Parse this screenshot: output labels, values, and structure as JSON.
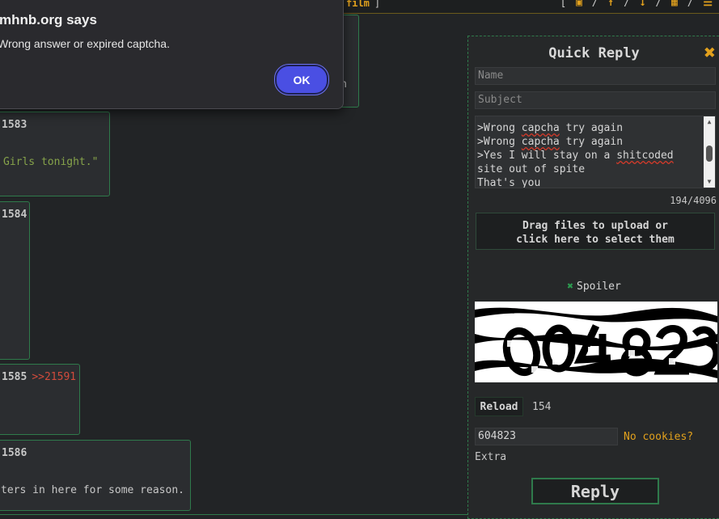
{
  "topbar": {
    "film_label": "film",
    "close_bracket": "]",
    "nav": [
      "[",
      "/",
      "/",
      "/",
      "/",
      "/"
    ]
  },
  "dialog": {
    "title": "mhnb.org says",
    "message": "Wrong answer or expired captcha.",
    "ok_label": "OK",
    "accent": "#4a4fe3"
  },
  "posts": [
    {
      "num": "1583",
      "ref": "",
      "text": "Girls tonight.\""
    },
    {
      "num": "1584",
      "ref": "",
      "text": ""
    },
    {
      "num": "1585",
      "ref": ">>21591",
      "text": ""
    },
    {
      "num": "1586",
      "ref": "",
      "text": "ters in here for some reason."
    }
  ],
  "quick_reply": {
    "title": "Quick Reply",
    "close_icon": "close-icon",
    "name_placeholder": "Name",
    "subject_placeholder": "Subject",
    "message_lines": [
      ">            ",
      ">Wrong capcha try again",
      ">Wrong capcha try again",
      ">Yes I will stay on a shitcoded",
      "site out of spite",
      "That's you"
    ],
    "char_counter": "194/4096",
    "dropzone_line1": "Drag files to upload or",
    "dropzone_line2": "click here to select them",
    "spoiler_label": "Spoiler",
    "reload_label": "Reload",
    "timer": "154",
    "captcha_value": "604823",
    "no_cookies_label": "No cookies?",
    "extra_label": "Extra",
    "reply_label": "Reply"
  },
  "colors": {
    "background": "#222426",
    "border_green": "#2f7a4b",
    "accent_orange": "#e2a11d",
    "greentext": "#86a34a",
    "quote_red": "#d24b3c"
  }
}
